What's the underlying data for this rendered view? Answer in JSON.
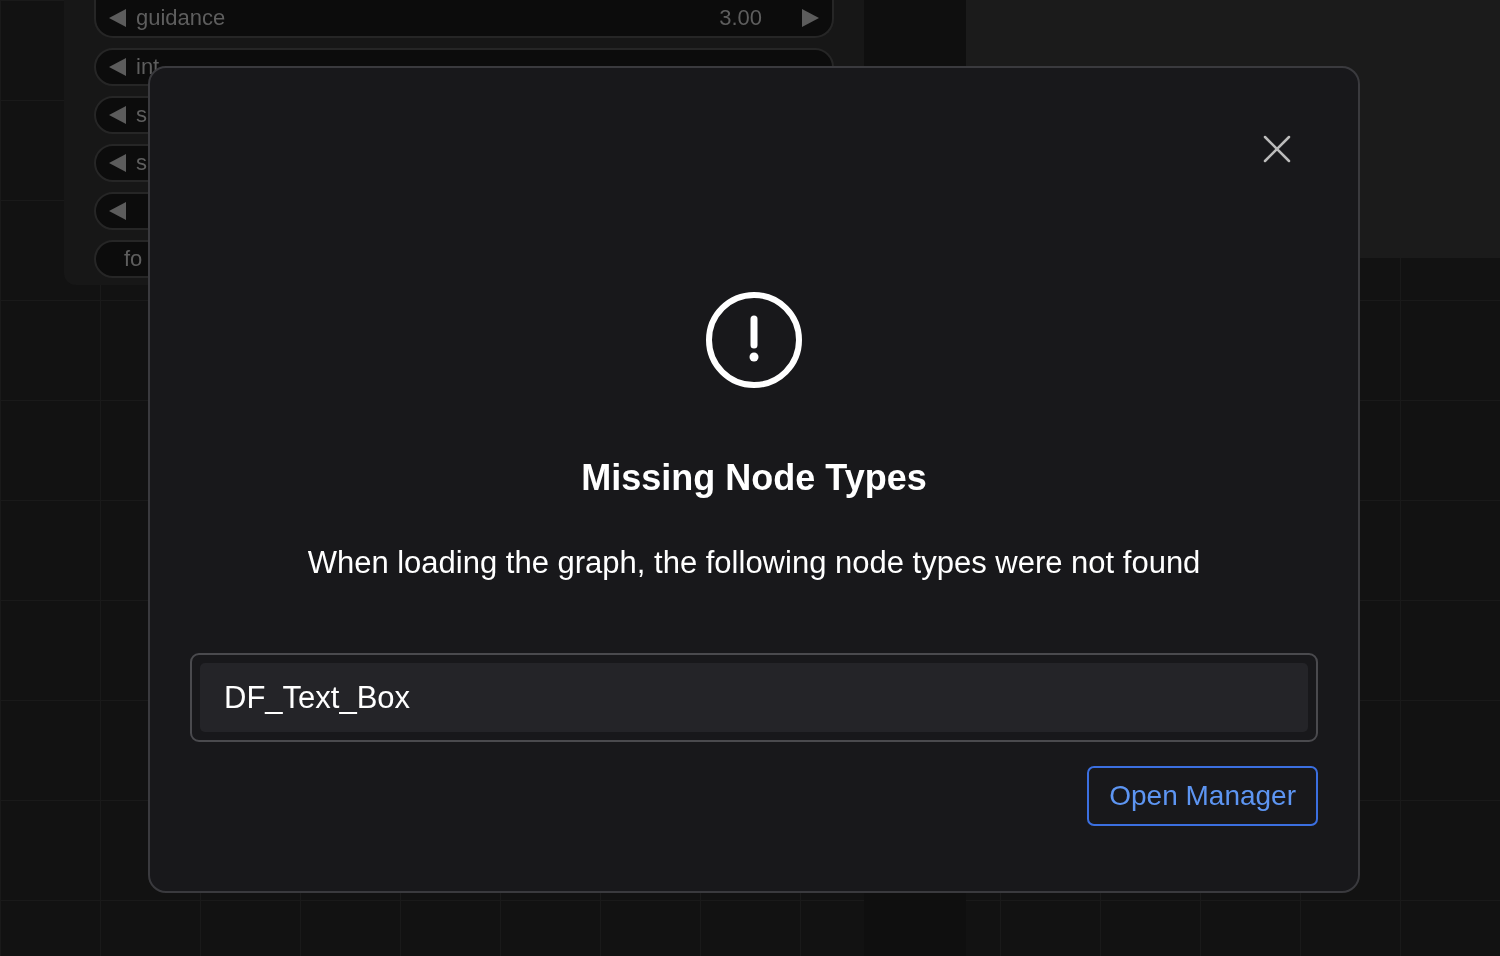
{
  "node": {
    "widgets": [
      {
        "kind": "number",
        "label": "guidance",
        "value": "3.00"
      },
      {
        "kind": "number",
        "label": "int"
      },
      {
        "kind": "number",
        "label": "s"
      },
      {
        "kind": "number",
        "label": "s"
      },
      {
        "kind": "number"
      },
      {
        "kind": "text",
        "label": "fo"
      }
    ]
  },
  "dialog": {
    "title": "Missing Node Types",
    "message": "When loading the graph, the following node types were not found",
    "missing": [
      "DF_Text_Box"
    ],
    "button": "Open Manager"
  }
}
